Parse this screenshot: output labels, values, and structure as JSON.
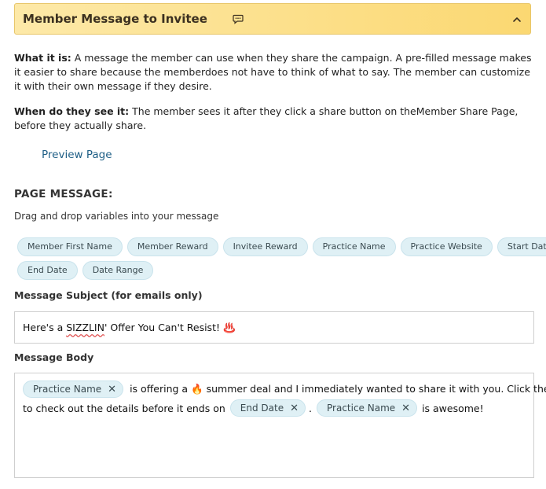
{
  "header": {
    "title": "Member Message to Invitee",
    "icon": "chat-icon",
    "toggle_icon": "chevron-up-icon",
    "bg_color": "#fbd872"
  },
  "info": {
    "what_label": "What it is:",
    "what_text": " A message the member can use when they share the campaign. A pre-filled message makes it easier to share because the memberdoes not have to think of what to say. The member can customize it with their own message if they desire.",
    "when_label": "When do they see it:",
    "when_text": " The member sees it after they click a share button on theMember Share Page, before they actually share."
  },
  "preview_link": "Preview Page",
  "page_message": {
    "title": "PAGE MESSAGE:",
    "helper": "Drag and drop variables into your message",
    "variables_row1": [
      "Member First Name",
      "Member Reward",
      "Invitee Reward",
      "Practice Name",
      "Practice Website",
      "Start Date"
    ],
    "variables_row2": [
      "End Date",
      "Date Range"
    ]
  },
  "subject": {
    "label": "Message Subject (for emails only)",
    "value_prefix": "Here's a ",
    "value_misspelled": "SIZZLIN",
    "value_suffix": "' Offer You Can't Resist! ♨️"
  },
  "body": {
    "label": "Message Body",
    "tag1": "Practice Name",
    "text1": "is offering a 🔥 summer deal and I immediately wanted to share it with you. Click the link",
    "text2": "to check out the details before it ends on",
    "tag2": "End Date",
    "text3": ".",
    "tag3": "Practice Name",
    "text4": "is awesome!",
    "remove_symbol": "✕"
  }
}
